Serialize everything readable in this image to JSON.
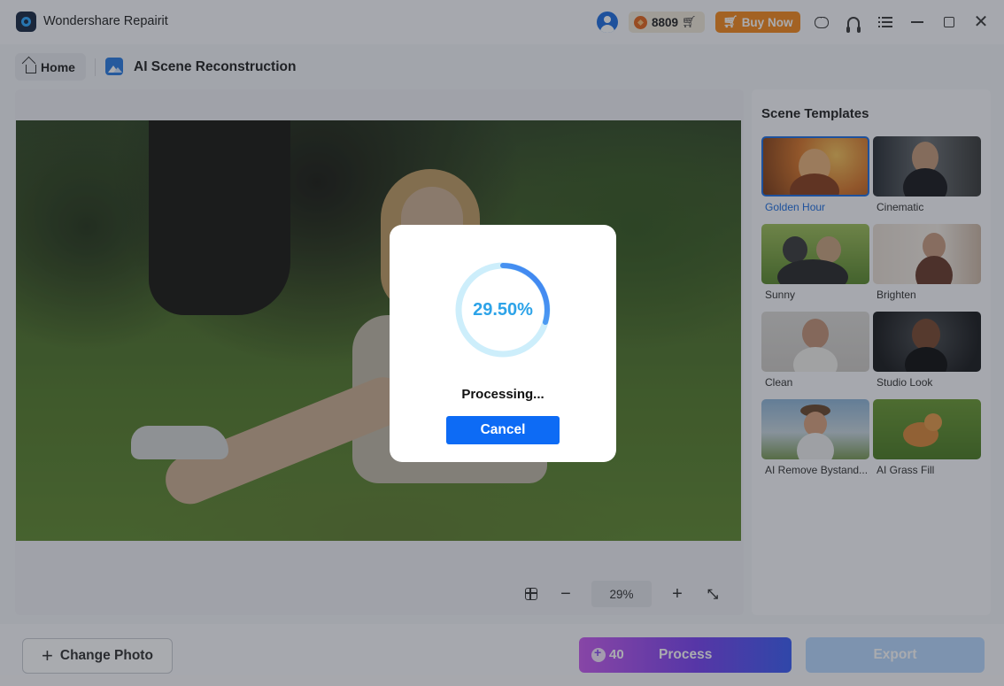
{
  "app": {
    "title": "Wondershare Repairit"
  },
  "header": {
    "credits": "8809",
    "buy_now_label": "Buy Now"
  },
  "breadcrumb": {
    "home_label": "Home",
    "page_title": "AI Scene Reconstruction"
  },
  "canvas": {
    "zoom_level": "29%"
  },
  "templates": {
    "title": "Scene Templates",
    "items": [
      {
        "label": "Golden Hour",
        "selected": true
      },
      {
        "label": "Cinematic",
        "selected": false
      },
      {
        "label": "Sunny",
        "selected": false
      },
      {
        "label": "Brighten",
        "selected": false
      },
      {
        "label": "Clean",
        "selected": false
      },
      {
        "label": "Studio Look",
        "selected": false
      },
      {
        "label": "AI Remove Bystand...",
        "selected": false
      },
      {
        "label": "AI Grass Fill",
        "selected": false
      }
    ]
  },
  "footer": {
    "change_photo_label": "Change Photo",
    "process_cost": "40",
    "process_label": "Process",
    "export_label": "Export"
  },
  "modal": {
    "progress_text": "29.50%",
    "progress_fraction": 0.295,
    "status_text": "Processing...",
    "cancel_label": "Cancel"
  },
  "colors": {
    "accent_blue": "#0d6bf5",
    "buy_now_orange": "#f5891e",
    "selected_outline": "#1f6fe0",
    "progress_cyan": "#2da3e8"
  }
}
